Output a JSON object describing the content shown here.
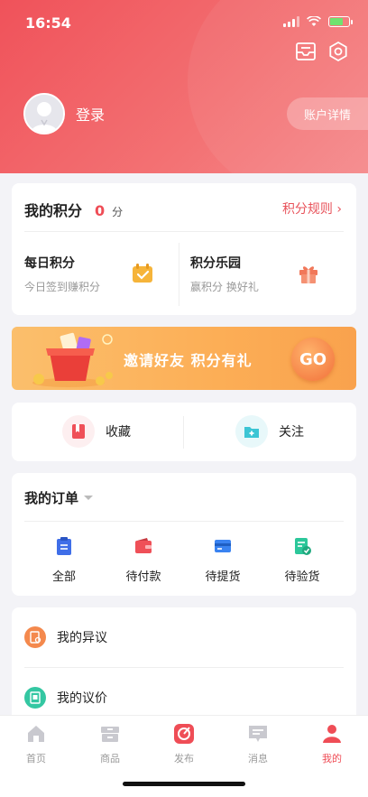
{
  "status_bar": {
    "time": "16:54"
  },
  "header": {
    "login_label": "登录",
    "account_detail_label": "账户详情"
  },
  "points": {
    "title": "我的积分",
    "value": "0",
    "unit": "分",
    "rules_label": "积分规则 ›",
    "daily": {
      "title": "每日积分",
      "subtitle": "今日签到赚积分"
    },
    "park": {
      "title": "积分乐园",
      "subtitle": "赢积分 换好礼"
    }
  },
  "banner": {
    "text": "邀请好友  积分有礼",
    "go_label": "GO"
  },
  "favorites": {
    "collect_label": "收藏",
    "follow_label": "关注"
  },
  "orders": {
    "title": "我的订单",
    "items": [
      {
        "label": "全部",
        "icon": "clipboard-icon",
        "color": "#3f6ee8"
      },
      {
        "label": "待付款",
        "icon": "wallet-icon",
        "color": "#ef5058"
      },
      {
        "label": "待提货",
        "icon": "card-icon",
        "color": "#3a83f1"
      },
      {
        "label": "待验货",
        "icon": "check-doc-icon",
        "color": "#2cc79a"
      }
    ]
  },
  "services": [
    {
      "label": "我的异议",
      "icon": "objection-icon",
      "color": "#f4894d"
    },
    {
      "label": "我的议价",
      "icon": "bargain-icon",
      "color": "#34c7a2"
    }
  ],
  "tabbar": {
    "items": [
      {
        "label": "首页",
        "icon": "home-icon",
        "active": false
      },
      {
        "label": "商品",
        "icon": "goods-icon",
        "active": false
      },
      {
        "label": "发布",
        "icon": "publish-icon",
        "active": false
      },
      {
        "label": "消息",
        "icon": "message-icon",
        "active": false
      },
      {
        "label": "我的",
        "icon": "profile-icon",
        "active": true
      }
    ]
  },
  "colors": {
    "brand": "#ef4d56",
    "banner": "#fcae56",
    "background": "#f3f3f7"
  }
}
